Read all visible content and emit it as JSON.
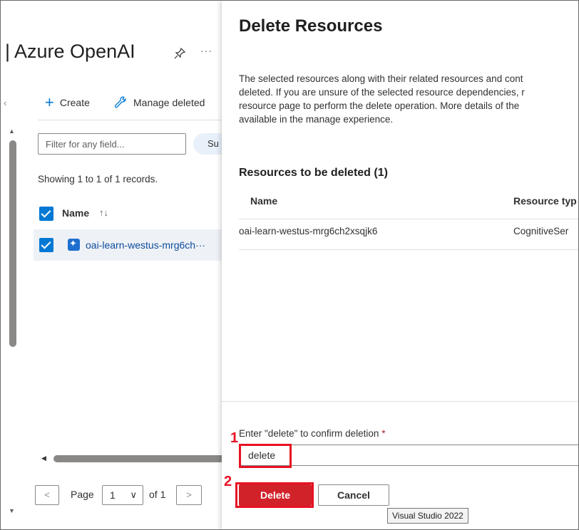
{
  "left_blade": {
    "title": "| Azure OpenAI",
    "more": "···",
    "collapse": "‹",
    "toolbar": {
      "create_label": "Create",
      "manage_label": "Manage deleted"
    },
    "filter": {
      "placeholder": "Filter for any field...",
      "value": ""
    },
    "sub_pill": "Su",
    "records_text": "Showing 1 to 1 of 1 records.",
    "column_header": "Name",
    "sort_glyph": "↑↓",
    "rows": [
      {
        "name": "oai-learn-westus-mrg6ch···",
        "selected": true
      }
    ],
    "pagination": {
      "prev": "<",
      "page_label": "Page",
      "current_page": "1",
      "chevron": "∨",
      "of_label": "of 1",
      "next": ">"
    }
  },
  "panel": {
    "title": "Delete Resources",
    "description_lines": [
      "The selected resources along with their related resources and cont",
      "deleted. If you are unsure of the selected resource dependencies, r",
      "resource page to perform the delete operation. More details of the",
      "available in the manage experience."
    ],
    "section_title": "Resources to be deleted (1)",
    "table": {
      "headers": [
        "Name",
        "Resource typ"
      ],
      "rows": [
        [
          "oai-learn-westus-mrg6ch2xsqjk6",
          "CognitiveSer"
        ]
      ]
    },
    "confirm": {
      "label": "Enter \"delete\" to confirm deletion",
      "required_mark": "*",
      "value": "delete"
    },
    "delete_label": "Delete",
    "cancel_label": "Cancel",
    "tooltip": "Visual Studio 2022"
  },
  "annotations": {
    "step1": "1",
    "step2": "2",
    "color": "#e81123"
  },
  "colors": {
    "accent": "#0078d4",
    "danger": "#d1222a"
  }
}
